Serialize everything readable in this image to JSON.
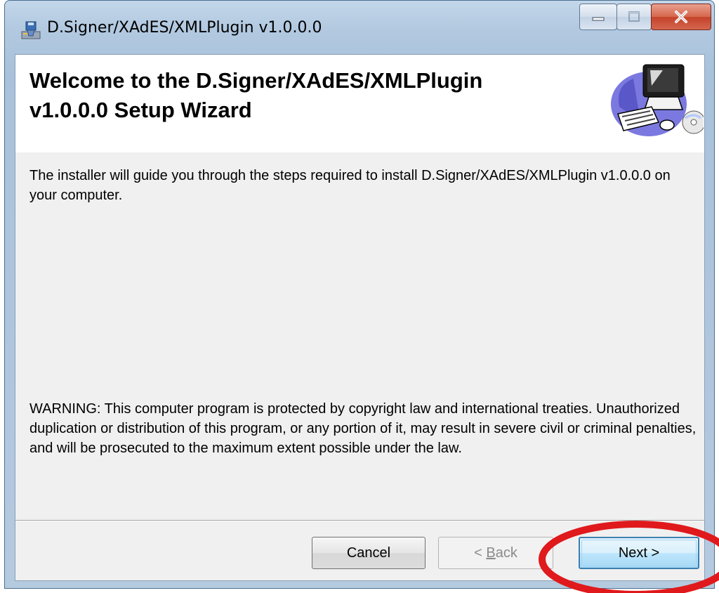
{
  "window": {
    "title": "D.Signer/XAdES/XMLPlugin v1.0.0.0"
  },
  "header": {
    "title": "Welcome to the D.Signer/XAdES/XMLPlugin v1.0.0.0 Setup Wizard",
    "art_icon": "computer-with-cd-icon"
  },
  "body": {
    "intro": "The installer will guide you through the steps required to install D.Signer/XAdES/XMLPlugin v1.0.0.0 on your computer.",
    "warning": "WARNING: This computer program is protected by copyright law and international treaties. Unauthorized duplication or distribution of this program, or any portion of it, may result in severe civil or criminal penalties, and will be prosecuted to the maximum extent possible under the law."
  },
  "buttons": {
    "cancel": "Cancel",
    "back_prefix": "< ",
    "back_accel": "B",
    "back_rest": "ack",
    "next": "Next >"
  },
  "annotation": {
    "highlight_color": "#e0191c"
  }
}
